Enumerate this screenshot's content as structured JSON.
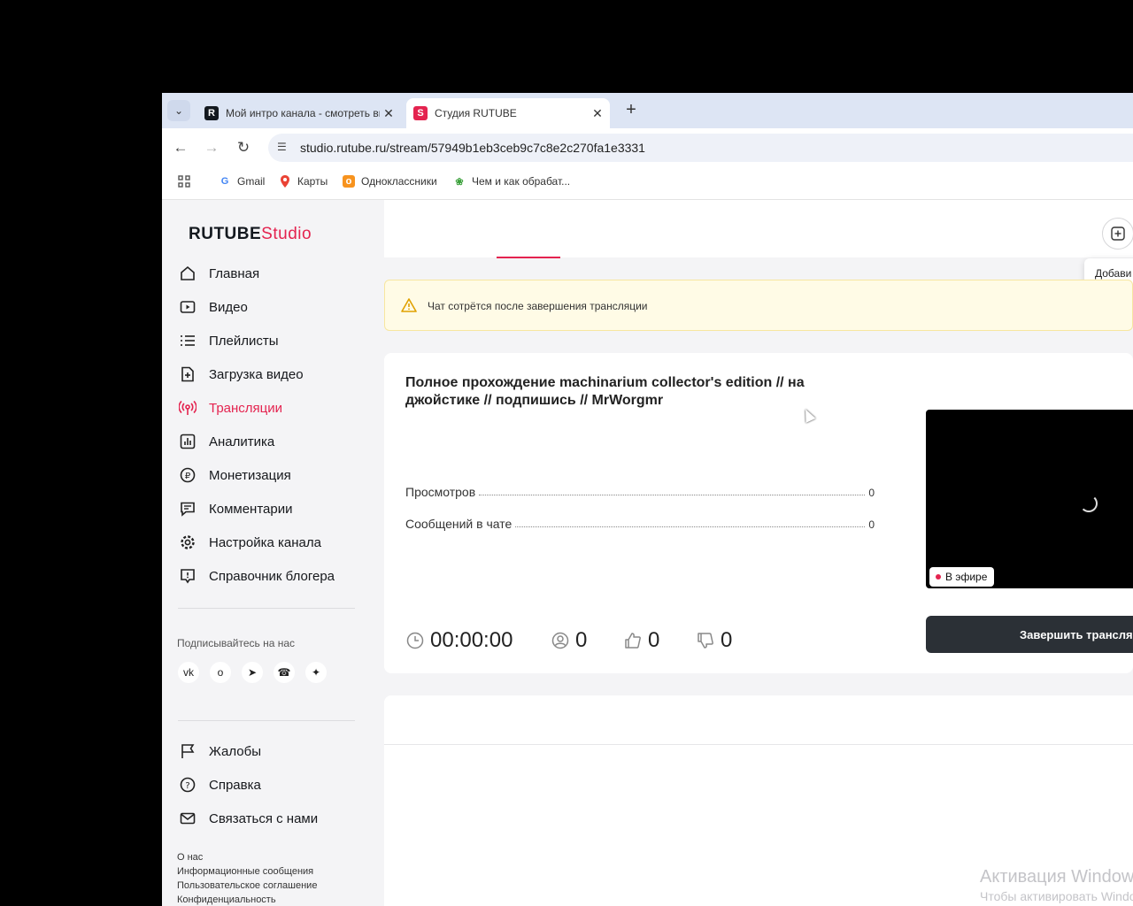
{
  "browser": {
    "tabs": [
      {
        "title": "Мой интро канала - смотреть видео"
      },
      {
        "title": "Студия RUTUBE"
      }
    ],
    "url": "studio.rutube.ru/stream/57949b1eb3ceb9c7c8e2c270fa1e3331",
    "bookmarks": [
      {
        "label": "Gmail"
      },
      {
        "label": "Карты"
      },
      {
        "label": "Одноклассники"
      },
      {
        "label": "Чем и как обрабат..."
      }
    ]
  },
  "logo": {
    "main": "RUTUBE",
    "sub": "Studio"
  },
  "sidebar": {
    "items": [
      {
        "label": "Главная"
      },
      {
        "label": "Видео"
      },
      {
        "label": "Плейлисты"
      },
      {
        "label": "Загрузка видео"
      },
      {
        "label": "Трансляции"
      },
      {
        "label": "Аналитика"
      },
      {
        "label": "Монетизация"
      },
      {
        "label": "Комментарии"
      },
      {
        "label": "Настройка канала"
      },
      {
        "label": "Справочник блогера"
      }
    ],
    "active_item": "Трансляции",
    "follow_label": "Подписывайтесь на нас",
    "bottom_items": [
      {
        "label": "Жалобы"
      },
      {
        "label": "Справка"
      },
      {
        "label": "Связаться с нами"
      }
    ],
    "footer_links": [
      "О нас",
      "Информационные сообщения",
      "Пользовательское соглашение",
      "Конфиденциальность"
    ]
  },
  "header": {
    "tooltip": "Добави"
  },
  "alert": {
    "text": "Чат сотрётся после завершения трансляции"
  },
  "stream": {
    "title": "Полное прохождение machinarium collector's edition // на джойстике // подпишись // MrWorgmr",
    "stats": [
      {
        "label": "Просмотров",
        "value": "0"
      },
      {
        "label": "Сообщений в чате",
        "value": "0"
      }
    ],
    "duration": "00:00:00",
    "viewers": "0",
    "likes": "0",
    "dislikes": "0",
    "live_label": "В эфире",
    "end_button": "Завершить трансляцию"
  },
  "watermark": {
    "line1": "Активация Windows",
    "line2": "Чтобы активировать Windows"
  },
  "colors": {
    "accent": "#e4234f",
    "dark_button": "#2b3036",
    "alert_bg": "#fffbe6"
  }
}
